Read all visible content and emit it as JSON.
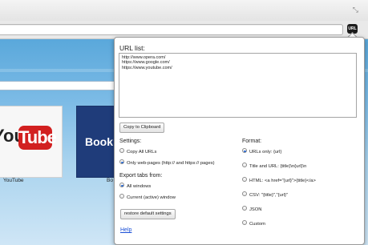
{
  "toolbar": {
    "ext_button_label": "URL",
    "resize_icon": "resize-icon"
  },
  "speeddial": {
    "tiles": [
      {
        "caption": "YouTube",
        "logo_a": "You",
        "logo_b": "Tube"
      },
      {
        "caption": "Bo",
        "logo": "Book"
      }
    ]
  },
  "popup": {
    "url_list_label": "URL list:",
    "url_list_value": "http://www.opera.com/\nhttps://www.google.com/\nhttps://www.youtube.com/",
    "copy_button": "Copy to Clipboard",
    "settings_label": "Settings:",
    "settings_options": [
      {
        "label": "Copy All URLs",
        "checked": false
      },
      {
        "label": "Only web-pages (http:// and https:// pages)",
        "checked": true
      }
    ],
    "export_label": "Export tabs from:",
    "export_options": [
      {
        "label": "All windows",
        "checked": true
      },
      {
        "label": "Current (active) window",
        "checked": false
      }
    ],
    "restore_button": "restore default settings",
    "format_label": "Format:",
    "format_options": [
      {
        "label": "URLs only: {url}",
        "checked": true
      },
      {
        "label": "Title and URL: {title}\\n{url}\\n",
        "checked": false
      },
      {
        "label": "HTML: <a href=\"{url}\">{title}</a>",
        "checked": false
      },
      {
        "label": "CSV: \"{title}\",\"{url}\"",
        "checked": false
      },
      {
        "label": "JSON",
        "checked": false
      },
      {
        "label": "Custom",
        "checked": false
      }
    ],
    "help_link": "Help"
  },
  "colors": {
    "accent": "#2a6ad1",
    "link": "#1a4fd6",
    "youtube_red": "#d22020",
    "booking_blue": "#1f3c7a"
  }
}
